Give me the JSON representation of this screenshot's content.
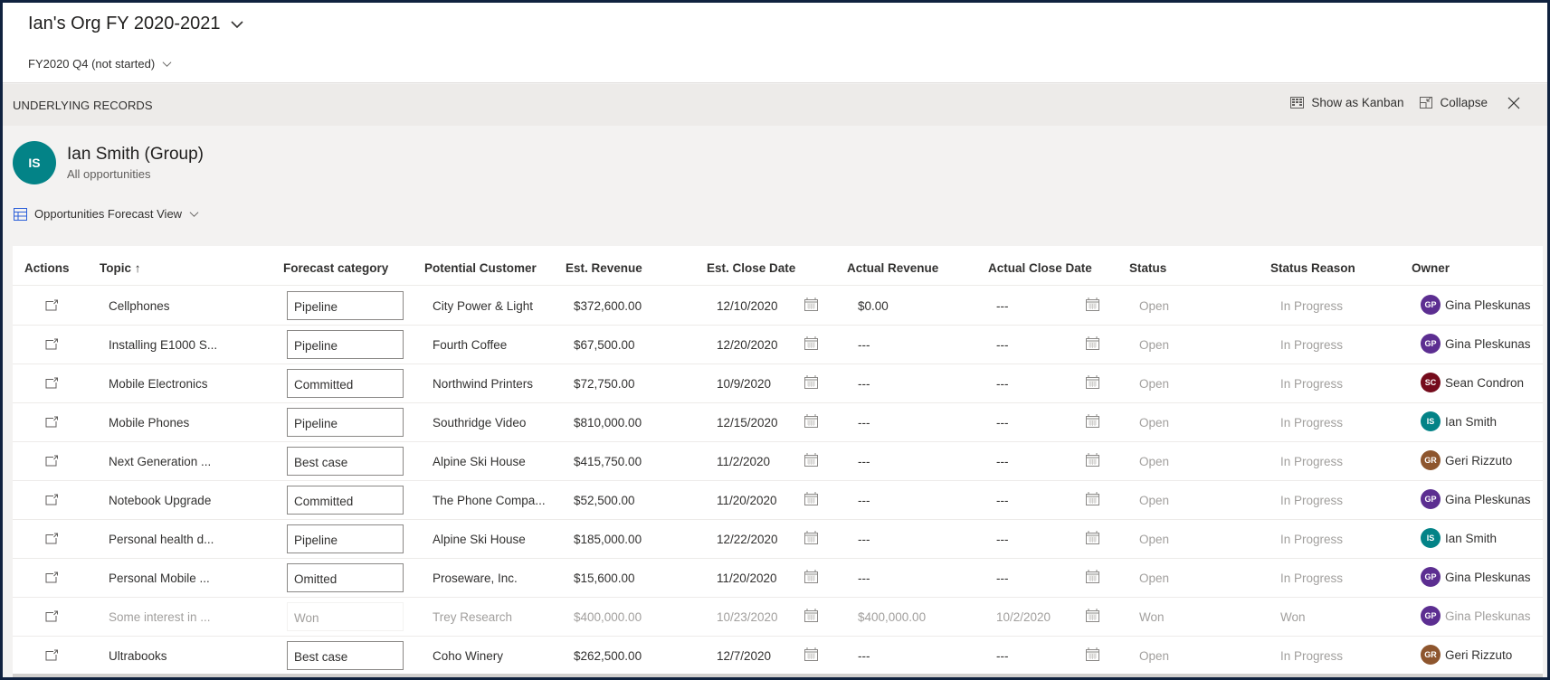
{
  "header": {
    "title": "Ian's Org FY 2020-2021",
    "period": "FY2020 Q4 (not started)"
  },
  "panel": {
    "title": "UNDERLYING RECORDS",
    "kanban_label": "Show as Kanban",
    "collapse_label": "Collapse"
  },
  "group": {
    "initials": "IS",
    "name": "Ian Smith (Group)",
    "subtitle": "All opportunities",
    "avatar_color": "#038387"
  },
  "view": {
    "label": "Opportunities Forecast View"
  },
  "table": {
    "columns": [
      "Actions",
      "Topic",
      "Forecast category",
      "Potential Customer",
      "Est. Revenue",
      "Est. Close Date",
      "Actual Revenue",
      "Actual Close Date",
      "Status",
      "Status Reason",
      "Owner"
    ],
    "sort_indicator": "↑",
    "rows": [
      {
        "topic": "Cellphones",
        "forecast": "Pipeline",
        "customer": "City Power & Light",
        "est_revenue": "$372,600.00",
        "est_close": "12/10/2020",
        "actual_revenue": "$0.00",
        "actual_close": "---",
        "status": "Open",
        "reason": "In Progress",
        "owner": "Gina Pleskunas",
        "owner_initials": "GP",
        "owner_color": "#5c2e91",
        "dim": false
      },
      {
        "topic": "Installing E1000 S...",
        "forecast": "Pipeline",
        "customer": "Fourth Coffee",
        "est_revenue": "$67,500.00",
        "est_close": "12/20/2020",
        "actual_revenue": "---",
        "actual_close": "---",
        "status": "Open",
        "reason": "In Progress",
        "owner": "Gina Pleskunas",
        "owner_initials": "GP",
        "owner_color": "#5c2e91",
        "dim": false
      },
      {
        "topic": "Mobile Electronics",
        "forecast": "Committed",
        "customer": "Northwind Printers",
        "est_revenue": "$72,750.00",
        "est_close": "10/9/2020",
        "actual_revenue": "---",
        "actual_close": "---",
        "status": "Open",
        "reason": "In Progress",
        "owner": "Sean Condron",
        "owner_initials": "SC",
        "owner_color": "#750b1c",
        "dim": false
      },
      {
        "topic": "Mobile Phones",
        "forecast": "Pipeline",
        "customer": "Southridge Video",
        "est_revenue": "$810,000.00",
        "est_close": "12/15/2020",
        "actual_revenue": "---",
        "actual_close": "---",
        "status": "Open",
        "reason": "In Progress",
        "owner": "Ian Smith",
        "owner_initials": "IS",
        "owner_color": "#038387",
        "dim": false
      },
      {
        "topic": "Next Generation ...",
        "forecast": "Best case",
        "customer": "Alpine Ski House",
        "est_revenue": "$415,750.00",
        "est_close": "11/2/2020",
        "actual_revenue": "---",
        "actual_close": "---",
        "status": "Open",
        "reason": "In Progress",
        "owner": "Geri Rizzuto",
        "owner_initials": "GR",
        "owner_color": "#8e562e",
        "dim": false
      },
      {
        "topic": "Notebook Upgrade",
        "forecast": "Committed",
        "customer": "The Phone Compa...",
        "est_revenue": "$52,500.00",
        "est_close": "11/20/2020",
        "actual_revenue": "---",
        "actual_close": "---",
        "status": "Open",
        "reason": "In Progress",
        "owner": "Gina Pleskunas",
        "owner_initials": "GP",
        "owner_color": "#5c2e91",
        "dim": false
      },
      {
        "topic": "Personal health d...",
        "forecast": "Pipeline",
        "customer": "Alpine Ski House",
        "est_revenue": "$185,000.00",
        "est_close": "12/22/2020",
        "actual_revenue": "---",
        "actual_close": "---",
        "status": "Open",
        "reason": "In Progress",
        "owner": "Ian Smith",
        "owner_initials": "IS",
        "owner_color": "#038387",
        "dim": false
      },
      {
        "topic": "Personal Mobile ...",
        "forecast": "Omitted",
        "customer": "Proseware, Inc.",
        "est_revenue": "$15,600.00",
        "est_close": "11/20/2020",
        "actual_revenue": "---",
        "actual_close": "---",
        "status": "Open",
        "reason": "In Progress",
        "owner": "Gina Pleskunas",
        "owner_initials": "GP",
        "owner_color": "#5c2e91",
        "dim": false
      },
      {
        "topic": "Some interest in ...",
        "forecast": "Won",
        "customer": "Trey Research",
        "est_revenue": "$400,000.00",
        "est_close": "10/23/2020",
        "actual_revenue": "$400,000.00",
        "actual_close": "10/2/2020",
        "status": "Won",
        "reason": "Won",
        "owner": "Gina Pleskunas",
        "owner_initials": "GP",
        "owner_color": "#5c2e91",
        "dim": true
      },
      {
        "topic": "Ultrabooks",
        "forecast": "Best case",
        "customer": "Coho Winery",
        "est_revenue": "$262,500.00",
        "est_close": "12/7/2020",
        "actual_revenue": "---",
        "actual_close": "---",
        "status": "Open",
        "reason": "In Progress",
        "owner": "Geri Rizzuto",
        "owner_initials": "GR",
        "owner_color": "#8e562e",
        "dim": false
      }
    ]
  }
}
